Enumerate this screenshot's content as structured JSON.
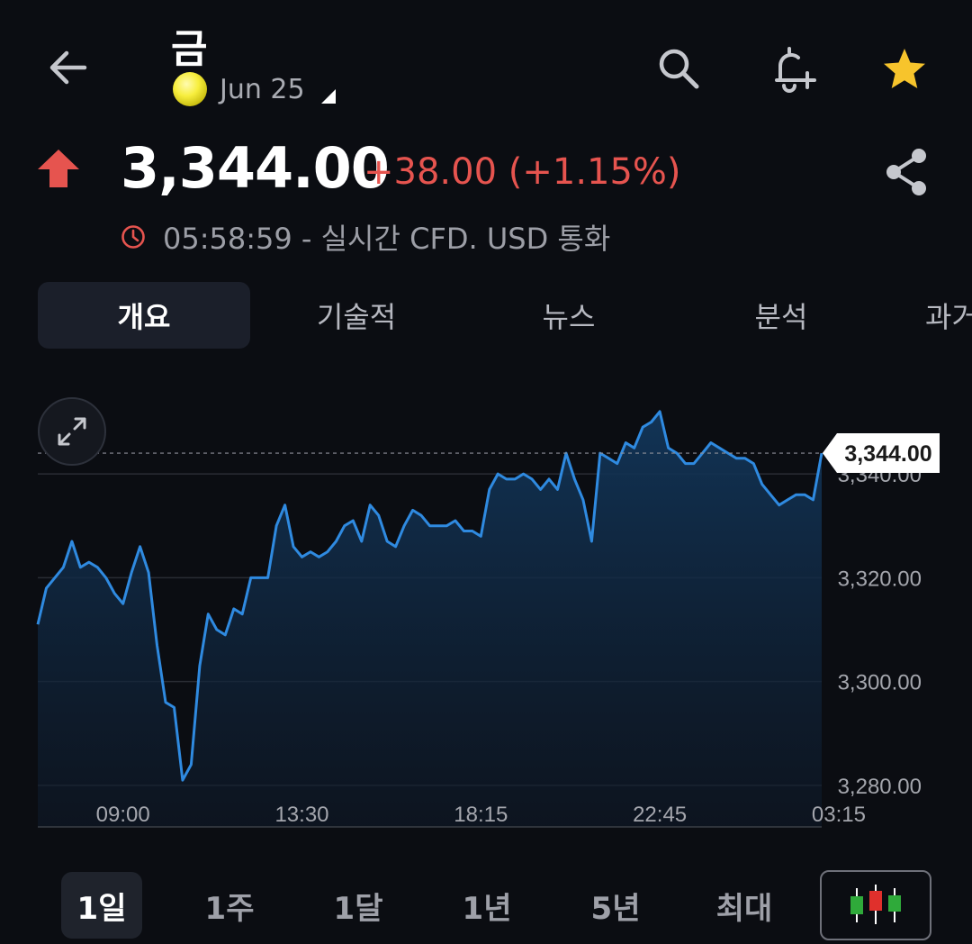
{
  "header": {
    "title": "금",
    "contract_label": "Jun 25",
    "icons": {
      "back": "arrow-left-icon",
      "search": "search-icon",
      "alert": "bell-plus-icon",
      "favorite": "star-icon",
      "share": "share-icon"
    }
  },
  "price": {
    "value": "3,344.00",
    "change": "+38.00 (+1.15%)",
    "direction": "up",
    "status": "05:58:59 - 실시간 CFD. USD 통화"
  },
  "tabs": [
    {
      "label": "개요",
      "active": true
    },
    {
      "label": "기술적",
      "active": false
    },
    {
      "label": "뉴스",
      "active": false
    },
    {
      "label": "분석",
      "active": false
    },
    {
      "label": "과거",
      "active": false
    }
  ],
  "ranges": [
    {
      "label": "1일",
      "active": true
    },
    {
      "label": "1주",
      "active": false
    },
    {
      "label": "1달",
      "active": false
    },
    {
      "label": "1년",
      "active": false
    },
    {
      "label": "5년",
      "active": false
    },
    {
      "label": "최대",
      "active": false
    }
  ],
  "colors": {
    "up": "#e6544f",
    "line": "#2f8ae0",
    "accent_star": "#f7c42c",
    "background": "#0b0d12"
  },
  "chart_data": {
    "type": "area",
    "x_ticks": [
      "09:00",
      "13:30",
      "18:15",
      "22:45",
      "03:15"
    ],
    "y_ticks": [
      "3,280.00",
      "3,300.00",
      "3,320.00",
      "3,340.00"
    ],
    "ylim": [
      3272,
      3348
    ],
    "last_price_label": "3,344.00",
    "last_price": 3344,
    "x": [
      0,
      1,
      2,
      3,
      4,
      5,
      6,
      7,
      8,
      9,
      10,
      11,
      12,
      13,
      14,
      15,
      16,
      17,
      18,
      19,
      20,
      21,
      22,
      23,
      24,
      25,
      26,
      27,
      28,
      29,
      30,
      31,
      32,
      33,
      34,
      35,
      36,
      37,
      38,
      39,
      40,
      41,
      42,
      43,
      44,
      45,
      46,
      47,
      48,
      49,
      50,
      51,
      52,
      53,
      54,
      55,
      56,
      57,
      58,
      59,
      60,
      61,
      62,
      63,
      64,
      65,
      66,
      67,
      68,
      69,
      70,
      71,
      72,
      73,
      74,
      75,
      76,
      77,
      78,
      79,
      80,
      81,
      82,
      83,
      84,
      85,
      86,
      87,
      88,
      89,
      90,
      91,
      92,
      93,
      94,
      95,
      96,
      97,
      98,
      99,
      100,
      101,
      102,
      103,
      104,
      105
    ],
    "values": [
      3311,
      3318,
      3320,
      3322,
      3327,
      3322,
      3323,
      3322,
      3320,
      3317,
      3315,
      3321,
      3326,
      3321,
      3307,
      3296,
      3295,
      3281,
      3284,
      3303,
      3313,
      3310,
      3309,
      3314,
      3313,
      3320,
      3320,
      3320,
      3330,
      3334,
      3326,
      3324,
      3325,
      3324,
      3325,
      3327,
      3330,
      3331,
      3327,
      3334,
      3332,
      3327,
      3326,
      3330,
      3333,
      3332,
      3330,
      3330,
      3330,
      3331,
      3329,
      3329,
      3328,
      3337,
      3340,
      3339,
      3339,
      3340,
      3339,
      3337,
      3339,
      3337,
      3344,
      3339,
      3335,
      3327,
      3344,
      3343,
      3342,
      3346,
      3345,
      3349,
      3350,
      3352,
      3345,
      3344,
      3342,
      3342,
      3344,
      3346,
      3345,
      3344,
      3343,
      3343,
      3342,
      3338,
      3336,
      3334,
      3335,
      3336,
      3336,
      3335,
      3344
    ]
  }
}
